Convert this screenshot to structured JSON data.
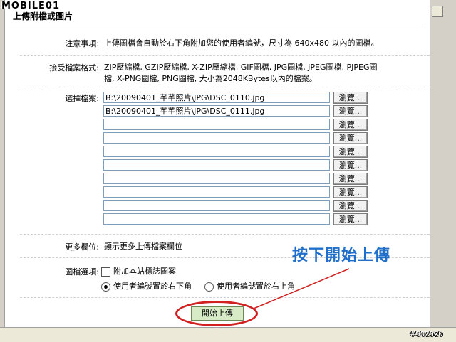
{
  "logo_text": "MOBILE01",
  "window": {
    "title": "上傳附檔或圖片"
  },
  "notes": {
    "label": "注意事項:",
    "text": "上傳圖檔會自動於右下角附加您的使用者編號，尺寸為 640x480 以內的圖檔。"
  },
  "accepted": {
    "label": "接受檔案格式:",
    "line1": "ZIP壓縮檔, GZIP壓縮檔, X-ZIP壓縮檔, GIF圖檔, JPG圖檔, JPEG圖檔, PJPEG圖",
    "line2": "檔, X-PNG圖檔, PNG圖檔, 大小為2048KBytes以內的檔案。"
  },
  "select_file": {
    "label": "選擇檔案:",
    "browse_label": "瀏覽...",
    "rows": [
      "B:\\20090401_芊芊照片\\JPG\\DSC_0110.jpg",
      "B:\\20090401_芊芊照片\\JPG\\DSC_0111.jpg",
      "",
      "",
      "",
      "",
      "",
      "",
      "",
      ""
    ]
  },
  "more_fields": {
    "label": "更多欄位:",
    "link": "顯示更多上傳檔案欄位"
  },
  "image_options": {
    "label": "圖檔選項:",
    "checkbox_label": "附加本站標誌圖案",
    "checkbox_checked": false,
    "radio1_label": "使用者編號置於右下角",
    "radio1_selected": true,
    "radio2_label": "使用者編號置於右上角",
    "radio2_selected": false
  },
  "start_button": "開始上傳",
  "annotation": "按下開始上傳",
  "annotation_color": "#1f6fcb",
  "highlight_color": "#d21f1f",
  "watermark": "#902920"
}
